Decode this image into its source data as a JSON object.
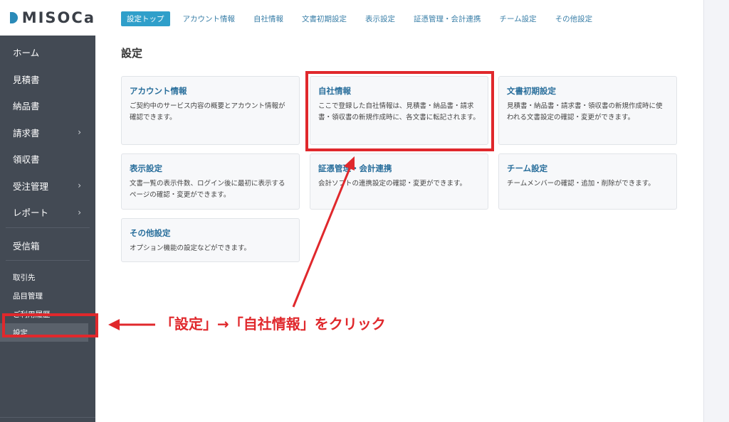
{
  "brand": {
    "logo_text": "MISOCa"
  },
  "sidebar": {
    "items": [
      {
        "label": "ホーム",
        "chevron": false
      },
      {
        "label": "見積書",
        "chevron": false
      },
      {
        "label": "納品書",
        "chevron": false
      },
      {
        "label": "請求書",
        "chevron": true
      },
      {
        "label": "領収書",
        "chevron": false
      },
      {
        "label": "受注管理",
        "chevron": true
      },
      {
        "label": "レポート",
        "chevron": true
      },
      {
        "label": "受信箱",
        "chevron": false
      }
    ],
    "sub_items": [
      {
        "label": "取引先"
      },
      {
        "label": "品目管理"
      },
      {
        "label": "ご利用履歴"
      },
      {
        "label": "設定",
        "active": true
      }
    ],
    "chevron_glyph": "›"
  },
  "tabs": [
    {
      "label": "設定トップ",
      "active": true
    },
    {
      "label": "アカウント情報"
    },
    {
      "label": "自社情報"
    },
    {
      "label": "文書初期設定"
    },
    {
      "label": "表示設定"
    },
    {
      "label": "証憑管理・会計連携"
    },
    {
      "label": "チーム設定"
    },
    {
      "label": "その他設定"
    }
  ],
  "page": {
    "title": "設定"
  },
  "cards": [
    {
      "title": "アカウント情報",
      "desc": "ご契約中のサービス内容の概要とアカウント情報が確認できます。"
    },
    {
      "title": "自社情報",
      "desc": "ここで登録した自社情報は、見積書・納品書・請求書・領収書の新規作成時に、各文書に転記されます。"
    },
    {
      "title": "文書初期設定",
      "desc": "見積書・納品書・請求書・領収書の新規作成時に使われる文書設定の確認・変更ができます。"
    },
    {
      "title": "表示設定",
      "desc": "文書一覧の表示件数、ログイン後に最初に表示するページの確認・変更ができます。"
    },
    {
      "title": "証憑管理・会計連携",
      "desc": "会計ソフトの連携設定の確認・変更ができます。"
    },
    {
      "title": "チーム設定",
      "desc": "チームメンバーの確認・追加・削除ができます。"
    },
    {
      "title": "その他設定",
      "desc": "オプション機能の設定などができます。"
    }
  ],
  "annotation": {
    "text": "「設定」→「自社情報」をクリック",
    "color": "#e0282c"
  },
  "colors": {
    "sidebar_bg": "#434a54",
    "accent": "#2f9fca",
    "link": "#2a6f9c"
  }
}
